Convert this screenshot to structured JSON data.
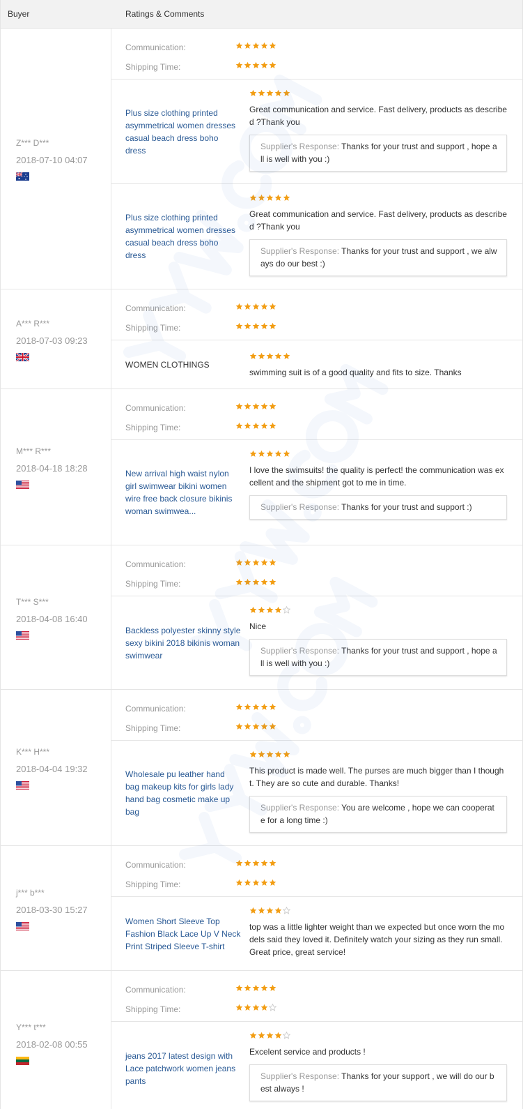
{
  "header": {
    "buyer_label": "Buyer",
    "ratings_label": "Ratings & Comments"
  },
  "labels": {
    "communication": "Communication:",
    "shipping": "Shipping Time:",
    "response": "Supplier's Response:"
  },
  "colors": {
    "star_full": "#f29d13",
    "star_empty": "#cccccc",
    "link": "#2a5a95"
  },
  "feedbacks": [
    {
      "buyer": "Z*** D***",
      "date": "2018-07-10 04:07",
      "flag": "AU",
      "ratings": {
        "communication": 5,
        "shipping": 5
      },
      "items": [
        {
          "product": "Plus size clothing printed asymmetrical women dresses casual beach dress boho dress",
          "is_link": true,
          "stars": 5,
          "comment": "Great communication and service. Fast delivery, products as described ?Thank you",
          "response": "Thanks for your trust and support , hope all is well with you :)"
        },
        {
          "product": "Plus size clothing printed asymmetrical women dresses casual beach dress boho dress",
          "is_link": true,
          "stars": 5,
          "comment": "Great communication and service. Fast delivery, products as described ?Thank you",
          "response": "Thanks for your trust and support , we always do our best :)"
        }
      ]
    },
    {
      "buyer": "A*** R***",
      "date": "2018-07-03 09:23",
      "flag": "UK",
      "ratings": {
        "communication": 5,
        "shipping": 5
      },
      "items": [
        {
          "product": "WOMEN CLOTHINGS",
          "is_link": false,
          "stars": 5,
          "comment": "swimming suit is of a good quality and fits to size. Thanks",
          "response": ""
        }
      ]
    },
    {
      "buyer": "M*** R***",
      "date": "2018-04-18 18:28",
      "flag": "US",
      "ratings": {
        "communication": 5,
        "shipping": 5
      },
      "items": [
        {
          "product": "New arrival high waist nylon girl swimwear bikini women wire free back closure bikinis woman swimwea...",
          "is_link": true,
          "stars": 5,
          "comment": "I love the swimsuits! the quality is perfect! the communication was excellent and the shipment got to me in time.",
          "response": "Thanks for your trust and support :)"
        }
      ]
    },
    {
      "buyer": "T*** S***",
      "date": "2018-04-08 16:40",
      "flag": "US",
      "ratings": {
        "communication": 5,
        "shipping": 5
      },
      "items": [
        {
          "product": "Backless polyester skinny style sexy bikini 2018 bikinis woman swimwear",
          "is_link": true,
          "stars": 4,
          "comment": "Nice",
          "response": "Thanks for your trust and support , hope all is well with you :)"
        }
      ]
    },
    {
      "buyer": "K*** H***",
      "date": "2018-04-04 19:32",
      "flag": "US",
      "ratings": {
        "communication": 5,
        "shipping": 5
      },
      "items": [
        {
          "product": "Wholesale pu leather hand bag makeup kits for girls lady hand bag cosmetic make up bag",
          "is_link": true,
          "stars": 5,
          "comment": "This product is made well. The purses are much bigger than I thought. They are so cute and durable. Thanks!",
          "response": "You are welcome , hope we can cooperate for a long time :)"
        }
      ]
    },
    {
      "buyer": "j*** b***",
      "date": "2018-03-30 15:27",
      "flag": "US",
      "ratings": {
        "communication": 5,
        "shipping": 5
      },
      "items": [
        {
          "product": "Women Short Sleeve Top Fashion Black Lace Up V Neck Print Striped Sleeve T-shirt",
          "is_link": true,
          "stars": 4,
          "comment": "top was a little lighter weight than we expected but once worn the models said they loved it. Definitely watch your sizing as they run small. Great price, great service!",
          "response": ""
        }
      ]
    },
    {
      "buyer": "Y*** t***",
      "date": "2018-02-08 00:55",
      "flag": "LT",
      "ratings": {
        "communication": 5,
        "shipping": 4
      },
      "items": [
        {
          "product": "jeans 2017 latest design with Lace patchwork women jeans pants",
          "is_link": true,
          "stars": 4,
          "comment": "Excelent service and products !",
          "response": "Thanks for your support , we will do our best always !"
        }
      ]
    }
  ]
}
